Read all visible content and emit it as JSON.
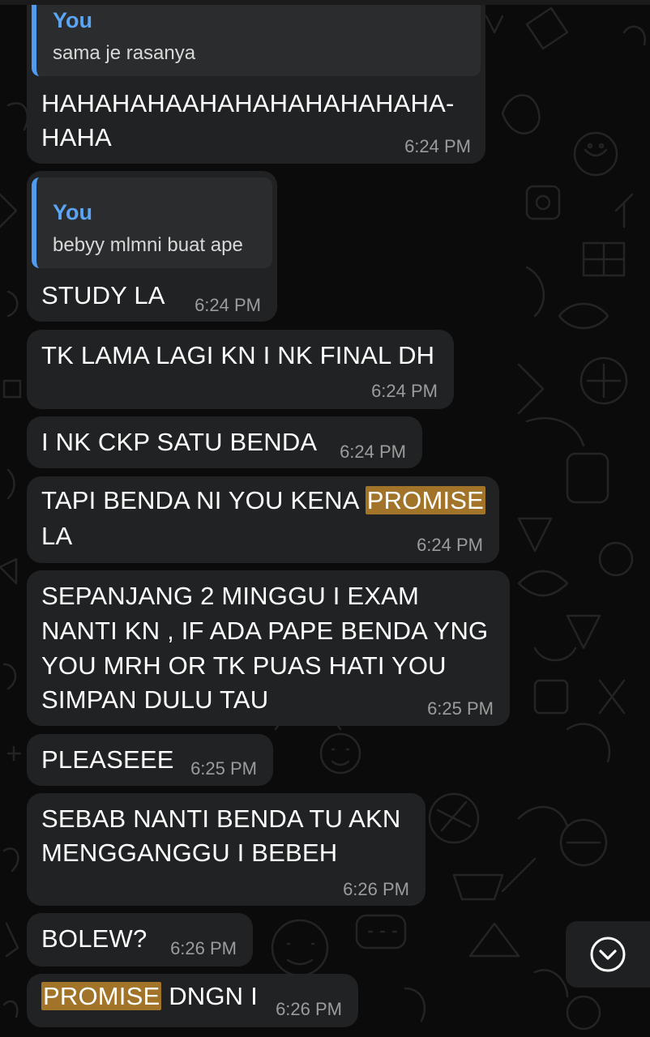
{
  "colors": {
    "background": "#0b0b0b",
    "bubble": "#202223",
    "quote_bg": "#2a2c2d",
    "quote_bar": "#4f9bef",
    "quote_author": "#5aa5f5",
    "highlight": "#a1742a",
    "timestamp": "#9c9c9c"
  },
  "messages": [
    {
      "quote": {
        "author": "You",
        "text": "sama je rasanya"
      },
      "lines": [
        "HAHAHAHAAHAHAHAHAHAHAHA-",
        "HAHA"
      ],
      "time": "6:24 PM"
    },
    {
      "quote": {
        "author": "You",
        "text": "bebyy mlmni buat ape"
      },
      "lines": [
        "STUDY LA"
      ],
      "time": "6:24 PM"
    },
    {
      "lines": [
        "TK LAMA LAGI KN I NK FINAL DH"
      ],
      "time": "6:24 PM"
    },
    {
      "lines": [
        "I NK CKP SATU BENDA"
      ],
      "time": "6:24 PM"
    },
    {
      "lines": [
        {
          "pre": "TAPI BENDA NI YOU KENA ",
          "highlight": "PROMISE",
          "post": ""
        },
        "LA"
      ],
      "time": "6:24 PM"
    },
    {
      "lines": [
        "SEPANJANG 2 MINGGU I EXAM",
        "NANTI KN , IF ADA PAPE BENDA YNG",
        "YOU MRH OR TK PUAS HATI YOU",
        "SIMPAN DULU TAU"
      ],
      "time": "6:25 PM"
    },
    {
      "lines": [
        "PLEASEEE"
      ],
      "time": "6:25 PM"
    },
    {
      "lines": [
        "SEBAB NANTI BENDA TU AKN",
        "MENGGANGGU I BEBEH"
      ],
      "time": "6:26 PM"
    },
    {
      "lines": [
        "BOLEW?"
      ],
      "time": "6:26 PM"
    },
    {
      "lines": [
        {
          "pre": "",
          "highlight": "PROMISE",
          "post": " DNGN I"
        }
      ],
      "time": "6:26 PM"
    }
  ],
  "scroll_button": {
    "icon": "chevron-down-circle-icon"
  }
}
